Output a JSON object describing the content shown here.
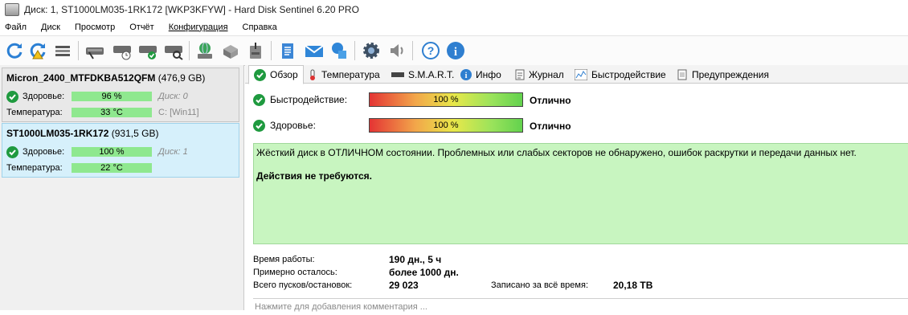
{
  "window": {
    "title": "Диск: 1, ST1000LM035-1RK172 [WKP3KFYW]  -  Hard Disk Sentinel 6.20 PRO"
  },
  "menu": [
    "Файл",
    "Диск",
    "Просмотр",
    "Отчёт",
    "Конфигурация",
    "Справка"
  ],
  "disks": [
    {
      "name": "Micron_2400_MTFDKBA512QFM",
      "capacity": "(476,9 GB)",
      "health_label": "Здоровье:",
      "health": "96 %",
      "health_fraction": 0.96,
      "disk_label": "Диск: 0",
      "temp_label": "Температура:",
      "temp": "33 °C",
      "drive": "C:",
      "drive_label": "[Win11]"
    },
    {
      "name": "ST1000LM035-1RK172",
      "capacity": "(931,5 GB)",
      "health_label": "Здоровье:",
      "health": "100 %",
      "health_fraction": 1.0,
      "disk_label": "Диск: 1",
      "temp_label": "Температура:",
      "temp": "22 °C"
    }
  ],
  "tabs": [
    "Обзор",
    "Температура",
    "S.M.A.R.T.",
    "Инфо",
    "Журнал",
    "Быстродействие",
    "Предупреждения"
  ],
  "overview": {
    "performance_label": "Быстродействие:",
    "performance_value": "100 %",
    "performance_fraction": 1.0,
    "performance_status": "Отлично",
    "health_label": "Здоровье:",
    "health_value": "100 %",
    "health_fraction": 1.0,
    "health_status": "Отлично",
    "status_text": "Жёсткий диск в ОТЛИЧНОМ состоянии. Проблемных или слабых секторов не обнаружено, ошибок раскрутки и передачи данных нет.",
    "action_text": "Действия не требуются.",
    "uptime_label": "Время работы:",
    "uptime_value": "190 дн., 5 ч",
    "remaining_label": "Примерно осталось:",
    "remaining_value": "более 1000 дн.",
    "starts_label": "Всего пусков/остановок:",
    "starts_value": "29 023",
    "written_label": "Записано за всё время:",
    "written_value": "20,18 TB",
    "comment_placeholder": "Нажмите для добавления комментария ..."
  },
  "colors": {
    "accent_green": "#1f9a3f",
    "status_bg": "#c8f5c0",
    "selected_disk_bg": "#d6f0fb"
  }
}
